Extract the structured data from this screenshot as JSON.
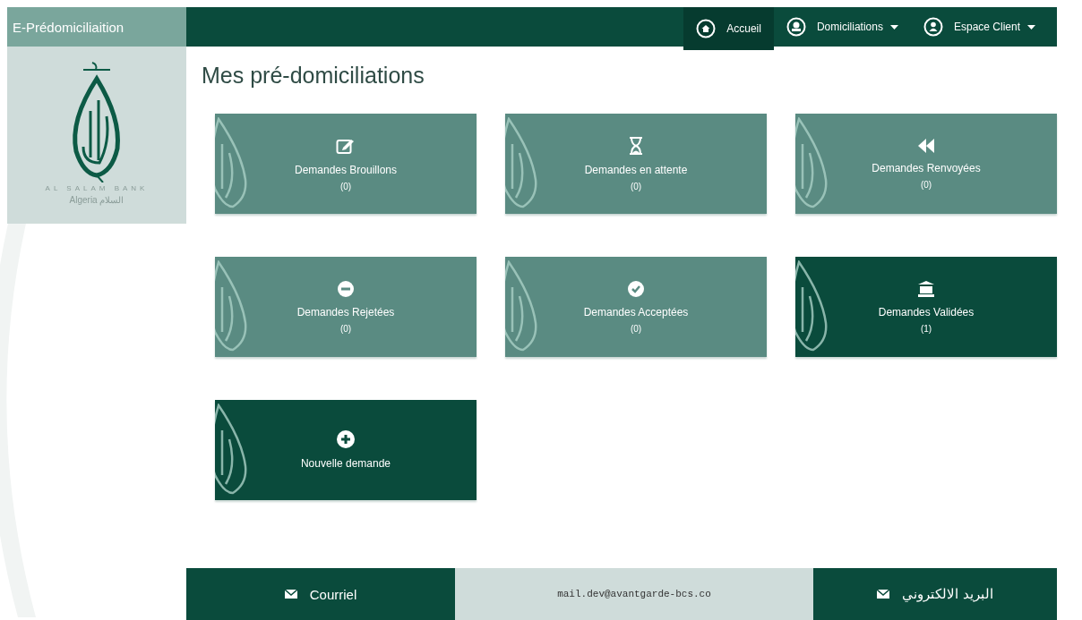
{
  "navbar": {
    "brand": "E-Prédomiciliaition",
    "items": [
      {
        "label": "Accueil",
        "selected": true,
        "dropdown": false
      },
      {
        "label": "Domiciliations",
        "selected": false,
        "dropdown": true
      },
      {
        "label": "Espace Client",
        "selected": false,
        "dropdown": true
      }
    ]
  },
  "sidebar": {
    "logo": {
      "name": "AL SALAM BANK",
      "subtitle": "Algeria  السلام"
    }
  },
  "page_title": "Mes pré-domiciliations",
  "cards": [
    {
      "kind": "draft",
      "label": "Demandes Brouillons",
      "count": "(0)",
      "highlighted": false
    },
    {
      "kind": "pending",
      "label": "Demandes en attente",
      "count": "(0)",
      "highlighted": false
    },
    {
      "kind": "returned",
      "label": "Demandes Renvoyées",
      "count": "(0)",
      "highlighted": false
    },
    {
      "kind": "rejected",
      "label": "Demandes Rejetées",
      "count": "(0)",
      "highlighted": false
    },
    {
      "kind": "accepted",
      "label": "Demandes Acceptées",
      "count": "(0)",
      "highlighted": false
    },
    {
      "kind": "validated",
      "label": "Demandes Validées",
      "count": "(1)",
      "highlighted": true
    },
    {
      "kind": "new",
      "label": "Nouvelle demande",
      "highlighted": true
    }
  ],
  "footer": {
    "mail_label": "Courriel",
    "email": "mail.dev@avantgarde-bcs.co",
    "mail_label_ar": "البريد الالكتروني"
  }
}
